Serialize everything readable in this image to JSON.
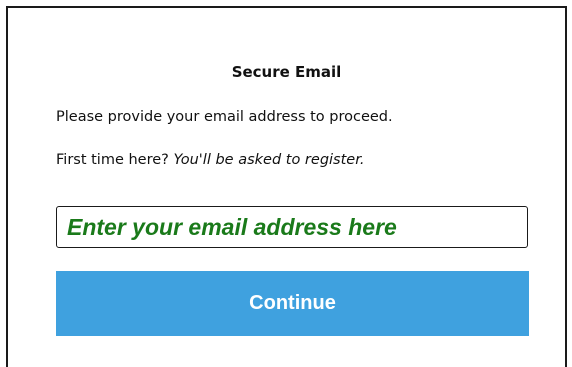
{
  "form": {
    "title": "Secure Email",
    "instruction": "Please provide your email address to proceed.",
    "first_time_prefix": "First time here? ",
    "first_time_note": "You'll be asked to register.",
    "email_placeholder": "Enter your email address here",
    "email_value": "",
    "continue_label": "Continue"
  },
  "colors": {
    "button_bg": "#3fa1df",
    "button_text": "#ffffff",
    "placeholder_text": "#1a7a1a",
    "border": "#1a1a1a"
  }
}
